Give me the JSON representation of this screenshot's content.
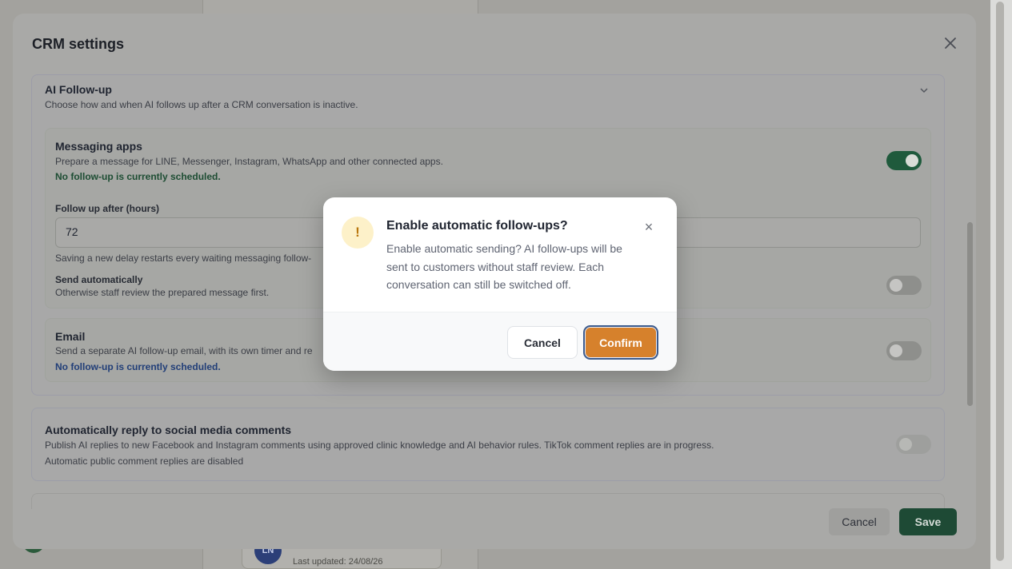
{
  "background": {
    "avatar_initials": "LN",
    "last_updated": "Last updated: 24/08/26"
  },
  "crm": {
    "title": "CRM settings",
    "close_icon": "close-icon",
    "ai_followup": {
      "title": "AI Follow-up",
      "description": "Choose how and when AI follows up after a CRM conversation is inactive.",
      "messaging": {
        "title": "Messaging apps",
        "description": "Prepare a message for LINE, Messenger, Instagram, WhatsApp and other connected apps.",
        "status": "No follow-up is currently scheduled.",
        "enabled": true,
        "delay_label": "Follow up after (hours)",
        "delay_value": "72",
        "delay_hint": "Saving a new delay restarts every waiting messaging follow-",
        "send_auto_label": "Send automatically",
        "send_auto_desc": "Otherwise staff review the prepared message first.",
        "send_auto_enabled": false
      },
      "email": {
        "title": "Email",
        "description": "Send a separate AI follow-up email, with its own timer and re",
        "status": "No follow-up is currently scheduled.",
        "enabled": false
      }
    },
    "social": {
      "title": "Automatically reply to social media comments",
      "description": "Publish AI replies to new Facebook and Instagram comments using approved clinic knowledge and AI behavior rules. TikTok comment replies are in progress.",
      "status": "Automatic public comment replies are disabled",
      "enabled": false
    },
    "footer": {
      "cancel": "Cancel",
      "save": "Save"
    }
  },
  "dialog": {
    "icon_glyph": "!",
    "icon": "warning-icon",
    "title": "Enable automatic follow-ups?",
    "body": "Enable automatic sending? AI follow-ups will be sent to customers without staff review. Each conversation can still be switched off.",
    "close_glyph": "×",
    "cancel": "Cancel",
    "confirm": "Confirm",
    "colors": {
      "confirm_bg": "#d6812c",
      "confirm_border": "#3b5a8c",
      "icon_bg": "#fdf1c9"
    }
  }
}
